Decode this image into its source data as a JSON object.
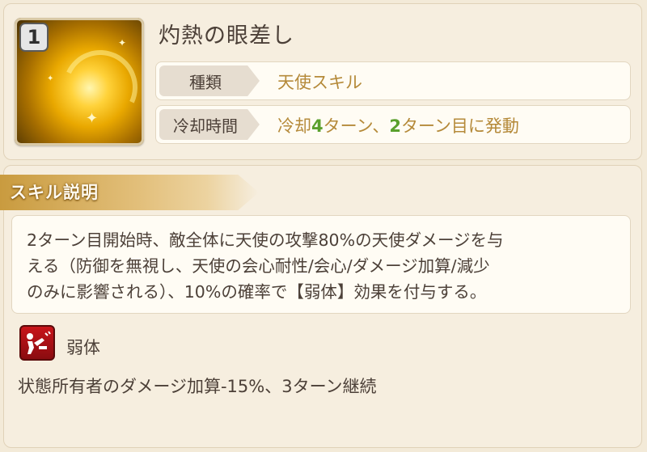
{
  "skill": {
    "rank": "1",
    "name": "灼熱の眼差し",
    "rows": [
      {
        "label": "種類",
        "value": "天使スキル"
      },
      {
        "label": "冷却時間",
        "value_parts": [
          "冷却",
          "4",
          "ターン、",
          "2",
          "ターン目に発動"
        ]
      }
    ],
    "icon": "golden-swirl-skill-icon"
  },
  "description": {
    "section_title": "スキル説明",
    "lines": [
      "2ターン目開始時、敵全体に天使の攻撃80%の天使ダメージを与",
      "える（防御を無視し、天使の会心耐性/会心/ダメージ加算/減少",
      "のみに影響される）、10%の確率で【弱体】効果を付与する。"
    ]
  },
  "debuff": {
    "name": "弱体",
    "icon": "weaken-debuff-icon",
    "effect": "状態所有者のダメージ加算-15%、3ターン継続"
  },
  "colors": {
    "value_gold": "#b58a3a",
    "highlight_green": "#5aa02c",
    "header_gold": "#c99b3f",
    "debuff_red": "#c8141a"
  }
}
